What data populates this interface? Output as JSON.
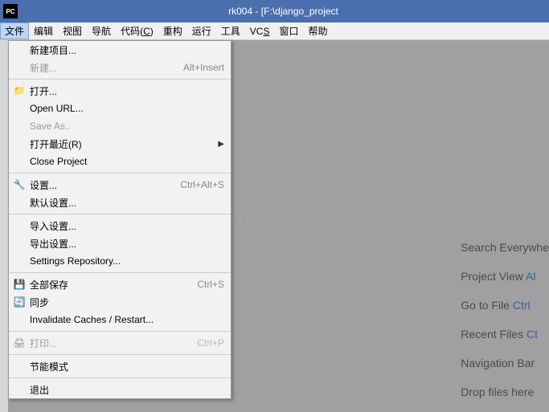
{
  "title": {
    "icon_text": "PC",
    "text": "rk004 - [F:\\django_project"
  },
  "menubar": {
    "items": [
      {
        "label": "文件",
        "active": true
      },
      {
        "label": "编辑"
      },
      {
        "label": "视图"
      },
      {
        "label": "导航"
      },
      {
        "label": "代码(C)"
      },
      {
        "label": "重构"
      },
      {
        "label": "运行"
      },
      {
        "label": "工具"
      },
      {
        "label": "VCS"
      },
      {
        "label": "窗口"
      },
      {
        "label": "帮助"
      }
    ]
  },
  "dropdown": {
    "items": [
      {
        "type": "item",
        "label": "新建项目..."
      },
      {
        "type": "item",
        "label": "新建...",
        "shortcut": "Alt+Insert",
        "disabled": true
      },
      {
        "type": "sep"
      },
      {
        "type": "item",
        "label": "打开...",
        "icon": "folder"
      },
      {
        "type": "item",
        "label": "Open URL..."
      },
      {
        "type": "item",
        "label": "Save As..",
        "disabled": true
      },
      {
        "type": "item",
        "label": "打开最近(R)",
        "submenu": true
      },
      {
        "type": "item",
        "label": "Close Project"
      },
      {
        "type": "sep"
      },
      {
        "type": "item",
        "label": "设置...",
        "shortcut": "Ctrl+Alt+S",
        "icon": "wrench"
      },
      {
        "type": "item",
        "label": "默认设置..."
      },
      {
        "type": "sep"
      },
      {
        "type": "item",
        "label": "导入设置..."
      },
      {
        "type": "item",
        "label": "导出设置..."
      },
      {
        "type": "item",
        "label": "Settings Repository..."
      },
      {
        "type": "sep"
      },
      {
        "type": "item",
        "label": "全部保存",
        "shortcut": "Ctrl+S",
        "icon": "save"
      },
      {
        "type": "item",
        "label": "同步",
        "icon": "sync"
      },
      {
        "type": "item",
        "label": "Invalidate Caches / Restart..."
      },
      {
        "type": "sep"
      },
      {
        "type": "item",
        "label": "打印...",
        "shortcut": "Ctrl+P",
        "disabled": true,
        "shortcut_disabled": true,
        "icon": "print"
      },
      {
        "type": "sep"
      },
      {
        "type": "item",
        "label": "节能模式"
      },
      {
        "type": "sep"
      },
      {
        "type": "item",
        "label": "退出"
      }
    ]
  },
  "hints": {
    "lines": [
      {
        "pre": "Search Everywhe",
        "hl": ""
      },
      {
        "pre": "Project View ",
        "hl": "Al"
      },
      {
        "pre": "Go to File ",
        "hl": "Ctrl"
      },
      {
        "pre": "Recent Files ",
        "hl": "Ct"
      },
      {
        "pre": "Navigation Bar ",
        "hl": ""
      },
      {
        "pre": "Drop files here",
        "hl": ""
      }
    ]
  },
  "watermark": "http://b",
  "icons": {
    "folder": "📁",
    "wrench": "🔧",
    "save": "💾",
    "sync": "🔄",
    "print": "🖨"
  }
}
